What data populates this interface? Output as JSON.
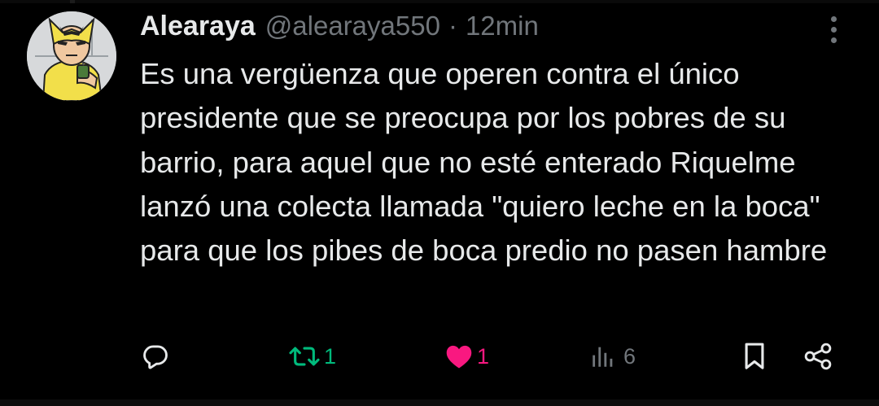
{
  "tweet": {
    "author": {
      "display_name": "Alearaya",
      "handle": "@alearaya550",
      "avatar_icon": "wolverine-avatar-icon"
    },
    "separator": "·",
    "time": "12min",
    "text": "Es una vergüenza que operen contra el único presidente que se preocupa por los pobres de su barrio, para aquel que no esté enterado Riquelme lanzó una colecta llamada \"quiero leche en la boca\" para que los pibes de boca predio no pasen hambre",
    "actions": {
      "reply": {
        "icon": "reply-icon"
      },
      "retweet": {
        "icon": "retweet-icon",
        "count": "1",
        "color": "#00ba7c"
      },
      "like": {
        "icon": "heart-icon",
        "count": "1",
        "color": "#f91880"
      },
      "views": {
        "icon": "views-icon",
        "count": "6"
      },
      "bookmark": {
        "icon": "bookmark-icon"
      },
      "share": {
        "icon": "share-icon"
      }
    },
    "more_icon": "more-vertical-icon"
  },
  "colors": {
    "background": "#000000",
    "text_primary": "#e7e9ea",
    "text_secondary": "#71767b"
  }
}
